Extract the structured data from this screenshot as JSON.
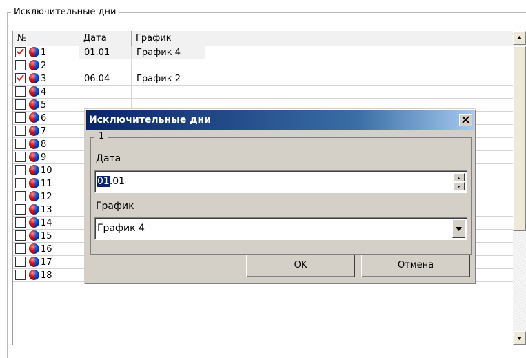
{
  "group": {
    "title": "Исключительные дни"
  },
  "grid": {
    "columns": [
      "№",
      "Дата",
      "График"
    ],
    "rows": [
      {
        "num": "1",
        "checked": true,
        "date": "01.01",
        "schedule": "График 4"
      },
      {
        "num": "2",
        "checked": false,
        "date": "",
        "schedule": ""
      },
      {
        "num": "3",
        "checked": true,
        "date": "06.04",
        "schedule": "График 2"
      },
      {
        "num": "4",
        "checked": false,
        "date": "",
        "schedule": ""
      },
      {
        "num": "5",
        "checked": false,
        "date": "",
        "schedule": ""
      },
      {
        "num": "6",
        "checked": false,
        "date": "",
        "schedule": ""
      },
      {
        "num": "7",
        "checked": false,
        "date": "",
        "schedule": ""
      },
      {
        "num": "8",
        "checked": false,
        "date": "",
        "schedule": ""
      },
      {
        "num": "9",
        "checked": false,
        "date": "",
        "schedule": ""
      },
      {
        "num": "10",
        "checked": false,
        "date": "",
        "schedule": ""
      },
      {
        "num": "11",
        "checked": false,
        "date": "",
        "schedule": ""
      },
      {
        "num": "12",
        "checked": false,
        "date": "",
        "schedule": ""
      },
      {
        "num": "13",
        "checked": false,
        "date": "",
        "schedule": ""
      },
      {
        "num": "14",
        "checked": false,
        "date": "",
        "schedule": ""
      },
      {
        "num": "15",
        "checked": false,
        "date": "",
        "schedule": ""
      },
      {
        "num": "16",
        "checked": false,
        "date": "",
        "schedule": ""
      },
      {
        "num": "17",
        "checked": false,
        "date": "",
        "schedule": ""
      },
      {
        "num": "18",
        "checked": false,
        "date": "",
        "schedule": ""
      }
    ]
  },
  "dialog": {
    "title": "Исключительные дни",
    "group_label": "1",
    "date_label": "Дата",
    "date_selected": "01",
    "date_rest": ".01",
    "schedule_label": "График",
    "schedule_value": "График 4",
    "ok_label": "OK",
    "cancel_label": "Отмена"
  },
  "colors": {
    "check": "#e0201a",
    "title_bar_start": "#0a246a",
    "dialog_face": "#d4d0c8"
  }
}
